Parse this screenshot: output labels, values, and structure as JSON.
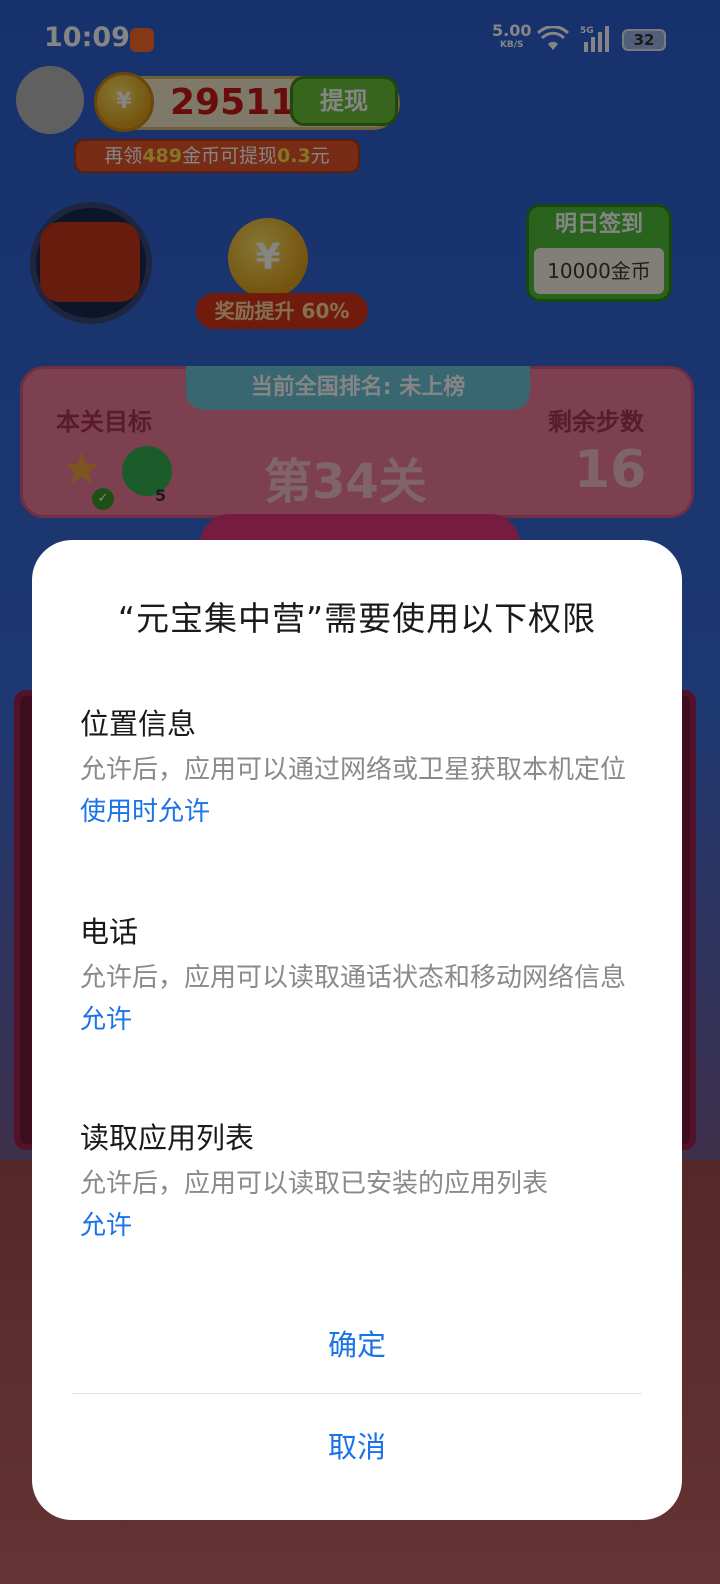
{
  "status_bar": {
    "time": "10:09",
    "net_speed": "5.00",
    "net_unit": "KB/S",
    "network_type": "5G",
    "battery": "32",
    "icons": [
      "app-notification-icon",
      "wifi-icon",
      "cell-signal-icon",
      "battery-icon"
    ]
  },
  "game": {
    "coin_count": "29511",
    "coin_symbol": "¥",
    "withdraw_label": "提现",
    "hint_prefix": "再领",
    "hint_amount": "489",
    "hint_middle": "金币可提现",
    "hint_money": "0.3",
    "hint_suffix": "元",
    "reward_label": "奖励提升 60%",
    "signin_title": "明日签到",
    "signin_value": "10000金币",
    "rank_label": "当前全国排名: 未上榜",
    "goal_label": "本关目标",
    "steps_label": "剩余步数",
    "level_label": "第34关",
    "steps_value": "16",
    "goal_count": "5"
  },
  "dialog": {
    "title": "“元宝集中营”需要使用以下权限",
    "permissions": [
      {
        "name": "位置信息",
        "description": "允许后，应用可以通过网络或卫星获取本机定位",
        "status": "使用时允许"
      },
      {
        "name": "电话",
        "description": "允许后，应用可以读取通话状态和移动网络信息",
        "status": "允许"
      },
      {
        "name": "读取应用列表",
        "description": "允许后，应用可以读取已安装的应用列表",
        "status": "允许"
      }
    ],
    "confirm_label": "确定",
    "cancel_label": "取消"
  },
  "colors": {
    "accent": "#1a73e8",
    "title_text": "#1a1a1a",
    "secondary_text": "#8a8a8a",
    "dialog_bg": "#ffffff"
  }
}
